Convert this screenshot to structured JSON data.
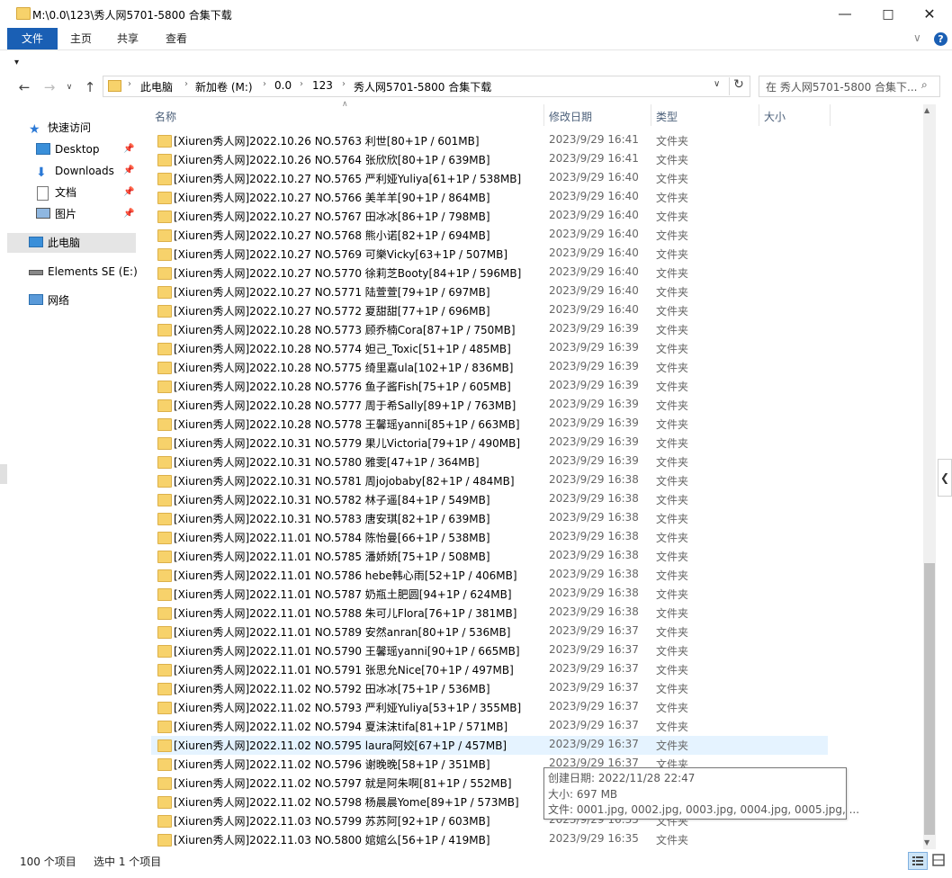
{
  "window": {
    "title": "M:\\0.0\\123\\秀人网5701-5800 合集下载"
  },
  "ribbon": {
    "tabs": [
      "文件",
      "主页",
      "共享",
      "查看"
    ]
  },
  "address": {
    "crumbs": [
      "此电脑",
      "新加卷 (M:)",
      "0.0",
      "123",
      "秀人网5701-5800 合集下载"
    ],
    "search_placeholder": "在 秀人网5701-5800 合集下..."
  },
  "nav": {
    "quick_access": "快速访问",
    "items": [
      "Desktop",
      "Downloads",
      "文档",
      "图片"
    ],
    "this_pc": "此电脑",
    "drive": "Elements SE (E:)",
    "network": "网络"
  },
  "columns": {
    "name": "名称",
    "date": "修改日期",
    "type": "类型",
    "size": "大小"
  },
  "rows": [
    {
      "name": "[Xiuren秀人网]2022.10.26 NO.5763 利世[80+1P / 601MB]",
      "date": "2023/9/29 16:41",
      "type": "文件夹"
    },
    {
      "name": "[Xiuren秀人网]2022.10.26 NO.5764 张欣欣[80+1P / 639MB]",
      "date": "2023/9/29 16:41",
      "type": "文件夹"
    },
    {
      "name": "[Xiuren秀人网]2022.10.27 NO.5765 严利娅Yuliya[61+1P / 538MB]",
      "date": "2023/9/29 16:40",
      "type": "文件夹"
    },
    {
      "name": "[Xiuren秀人网]2022.10.27 NO.5766 美羊羊[90+1P / 864MB]",
      "date": "2023/9/29 16:40",
      "type": "文件夹"
    },
    {
      "name": "[Xiuren秀人网]2022.10.27 NO.5767 田冰冰[86+1P / 798MB]",
      "date": "2023/9/29 16:40",
      "type": "文件夹"
    },
    {
      "name": "[Xiuren秀人网]2022.10.27 NO.5768 熊小诺[82+1P / 694MB]",
      "date": "2023/9/29 16:40",
      "type": "文件夹"
    },
    {
      "name": "[Xiuren秀人网]2022.10.27 NO.5769 可樂Vicky[63+1P / 507MB]",
      "date": "2023/9/29 16:40",
      "type": "文件夹"
    },
    {
      "name": "[Xiuren秀人网]2022.10.27 NO.5770 徐莉芝Booty[84+1P / 596MB]",
      "date": "2023/9/29 16:40",
      "type": "文件夹"
    },
    {
      "name": "[Xiuren秀人网]2022.10.27 NO.5771 陆萱萱[79+1P / 697MB]",
      "date": "2023/9/29 16:40",
      "type": "文件夹"
    },
    {
      "name": "[Xiuren秀人网]2022.10.27 NO.5772 夏甜甜[77+1P / 696MB]",
      "date": "2023/9/29 16:40",
      "type": "文件夹"
    },
    {
      "name": "[Xiuren秀人网]2022.10.28 NO.5773 顾乔楠Cora[87+1P / 750MB]",
      "date": "2023/9/29 16:39",
      "type": "文件夹"
    },
    {
      "name": "[Xiuren秀人网]2022.10.28 NO.5774 妲己_Toxic[51+1P / 485MB]",
      "date": "2023/9/29 16:39",
      "type": "文件夹"
    },
    {
      "name": "[Xiuren秀人网]2022.10.28 NO.5775 绮里嘉ula[102+1P / 836MB]",
      "date": "2023/9/29 16:39",
      "type": "文件夹"
    },
    {
      "name": "[Xiuren秀人网]2022.10.28 NO.5776 鱼子酱Fish[75+1P / 605MB]",
      "date": "2023/9/29 16:39",
      "type": "文件夹"
    },
    {
      "name": "[Xiuren秀人网]2022.10.28 NO.5777 周于希Sally[89+1P / 763MB]",
      "date": "2023/9/29 16:39",
      "type": "文件夹"
    },
    {
      "name": "[Xiuren秀人网]2022.10.28 NO.5778 王馨瑶yanni[85+1P / 663MB]",
      "date": "2023/9/29 16:39",
      "type": "文件夹"
    },
    {
      "name": "[Xiuren秀人网]2022.10.31 NO.5779 果儿Victoria[79+1P / 490MB]",
      "date": "2023/9/29 16:39",
      "type": "文件夹"
    },
    {
      "name": "[Xiuren秀人网]2022.10.31 NO.5780 雅雯[47+1P / 364MB]",
      "date": "2023/9/29 16:39",
      "type": "文件夹"
    },
    {
      "name": "[Xiuren秀人网]2022.10.31 NO.5781 周jojobaby[82+1P / 484MB]",
      "date": "2023/9/29 16:38",
      "type": "文件夹"
    },
    {
      "name": "[Xiuren秀人网]2022.10.31 NO.5782 林子遥[84+1P / 549MB]",
      "date": "2023/9/29 16:38",
      "type": "文件夹"
    },
    {
      "name": "[Xiuren秀人网]2022.10.31 NO.5783 唐安琪[82+1P / 639MB]",
      "date": "2023/9/29 16:38",
      "type": "文件夹"
    },
    {
      "name": "[Xiuren秀人网]2022.11.01 NO.5784 陈怡曼[66+1P / 538MB]",
      "date": "2023/9/29 16:38",
      "type": "文件夹"
    },
    {
      "name": "[Xiuren秀人网]2022.11.01 NO.5785 潘娇娇[75+1P / 508MB]",
      "date": "2023/9/29 16:38",
      "type": "文件夹"
    },
    {
      "name": "[Xiuren秀人网]2022.11.01 NO.5786 hebe韩心雨[52+1P / 406MB]",
      "date": "2023/9/29 16:38",
      "type": "文件夹"
    },
    {
      "name": "[Xiuren秀人网]2022.11.01 NO.5787 奶瓶土肥圆[94+1P / 624MB]",
      "date": "2023/9/29 16:38",
      "type": "文件夹"
    },
    {
      "name": "[Xiuren秀人网]2022.11.01 NO.5788 朱可儿Flora[76+1P / 381MB]",
      "date": "2023/9/29 16:38",
      "type": "文件夹"
    },
    {
      "name": "[Xiuren秀人网]2022.11.01 NO.5789 安然anran[80+1P / 536MB]",
      "date": "2023/9/29 16:37",
      "type": "文件夹"
    },
    {
      "name": "[Xiuren秀人网]2022.11.01 NO.5790 王馨瑶yanni[90+1P / 665MB]",
      "date": "2023/9/29 16:37",
      "type": "文件夹"
    },
    {
      "name": "[Xiuren秀人网]2022.11.01 NO.5791 张思允Nice[70+1P / 497MB]",
      "date": "2023/9/29 16:37",
      "type": "文件夹"
    },
    {
      "name": "[Xiuren秀人网]2022.11.02 NO.5792 田冰冰[75+1P / 536MB]",
      "date": "2023/9/29 16:37",
      "type": "文件夹"
    },
    {
      "name": "[Xiuren秀人网]2022.11.02 NO.5793 严利娅Yuliya[53+1P / 355MB]",
      "date": "2023/9/29 16:37",
      "type": "文件夹"
    },
    {
      "name": "[Xiuren秀人网]2022.11.02 NO.5794 夏沫沫tifa[81+1P / 571MB]",
      "date": "2023/9/29 16:37",
      "type": "文件夹"
    },
    {
      "name": "[Xiuren秀人网]2022.11.02 NO.5795 laura阿姣[67+1P / 457MB]",
      "date": "2023/9/29 16:37",
      "type": "文件夹",
      "selected": true
    },
    {
      "name": "[Xiuren秀人网]2022.11.02 NO.5796 谢晚晚[58+1P / 351MB]",
      "date": "2023/9/29 16:37",
      "type": "文件夹"
    },
    {
      "name": "[Xiuren秀人网]2022.11.02 NO.5797 就是阿朱啊[81+1P / 552MB]",
      "date": "2023/9/29 16:36",
      "type": "文件夹"
    },
    {
      "name": "[Xiuren秀人网]2022.11.02 NO.5798 杨晨晨Yome[89+1P / 573MB]",
      "date": "2023/9/29 16:36",
      "type": "文件夹"
    },
    {
      "name": "[Xiuren秀人网]2022.11.03 NO.5799 苏苏阿[92+1P / 603MB]",
      "date": "2023/9/29 16:35",
      "type": "文件夹"
    },
    {
      "name": "[Xiuren秀人网]2022.11.03 NO.5800 婠婠么[56+1P / 419MB]",
      "date": "2023/9/29 16:35",
      "type": "文件夹"
    }
  ],
  "tooltip": {
    "created": "创建日期: 2022/11/28 22:47",
    "size": "大小: 697 MB",
    "files": "文件: 0001.jpg, 0002.jpg, 0003.jpg, 0004.jpg, 0005.jpg, ..."
  },
  "status": {
    "count": "100 个项目",
    "selected": "选中 1 个项目"
  },
  "colors": {
    "accent": "#1a5fb4",
    "selected_row": "#e5f3ff",
    "folder": "#f7d26b"
  }
}
